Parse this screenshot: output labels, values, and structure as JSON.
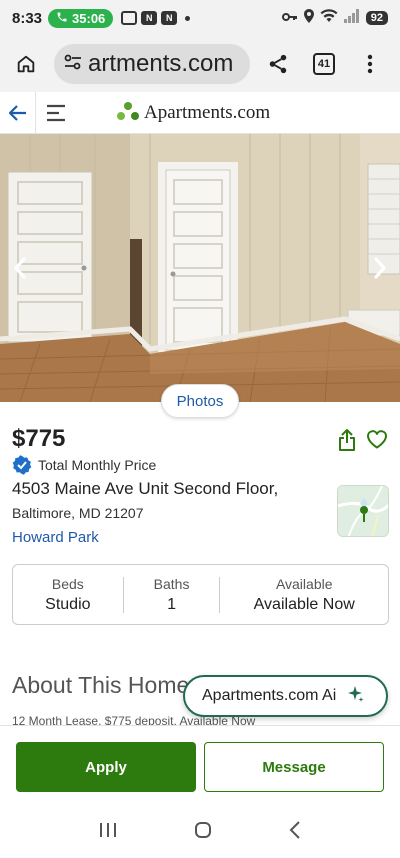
{
  "status_bar": {
    "time": "8:33",
    "call_timer": "35:06",
    "signal_label": "6",
    "battery": "92"
  },
  "browser": {
    "url_display": "artments.com",
    "tab_count": "41"
  },
  "site": {
    "brand_name": "Apartments.com"
  },
  "listing": {
    "photos_button": "Photos",
    "price": "$775",
    "price_note": "Total Monthly Price",
    "address_line1": "4503 Maine Ave Unit Second Floor,",
    "address_line2": "Baltimore, MD 21207",
    "neighborhood": "Howard Park",
    "stats": {
      "beds_label": "Beds",
      "beds_value": "Studio",
      "baths_label": "Baths",
      "baths_value": "1",
      "available_label": "Available",
      "available_value": "Available Now"
    },
    "about_title": "About This Home",
    "about_snippet": "12 Month Lease, $775 deposit, Available Now"
  },
  "ai_assistant": {
    "label": "Apartments.com Ai"
  },
  "actions": {
    "apply_label": "Apply",
    "message_label": "Message"
  },
  "colors": {
    "brand_green": "#2d7a0e",
    "link_blue": "#1e5aa8",
    "ai_border": "#1f6b54"
  }
}
